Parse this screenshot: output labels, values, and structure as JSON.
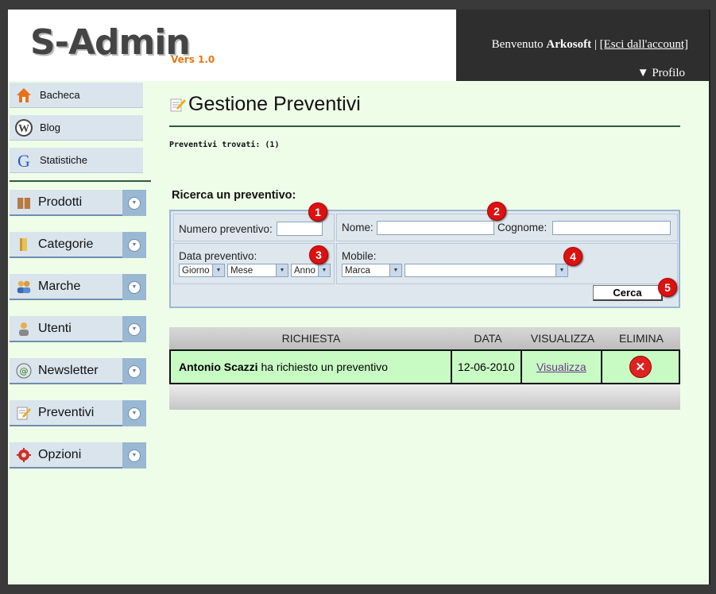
{
  "header": {
    "logo_text": "S-Admin",
    "logo_version": "Vers 1.0",
    "welcome_prefix": "Benvenuto",
    "username": "Arkosoft",
    "separator": "|",
    "logout_label": "[Esci dall'account]",
    "profile_label": "▼ Profilo"
  },
  "sidebar": {
    "top_items": [
      {
        "label": "Bacheca",
        "icon": "home-icon"
      },
      {
        "label": "Blog",
        "icon": "wordpress-icon"
      },
      {
        "label": "Statistiche",
        "icon": "google-icon"
      }
    ],
    "menu_items": [
      {
        "label": "Prodotti",
        "icon": "box-icon"
      },
      {
        "label": "Categorie",
        "icon": "folder-icon"
      },
      {
        "label": "Marche",
        "icon": "users-icon"
      },
      {
        "label": "Utenti",
        "icon": "user-icon"
      },
      {
        "label": "Newsletter",
        "icon": "email-icon"
      },
      {
        "label": "Preventivi",
        "icon": "document-edit-icon"
      },
      {
        "label": "Opzioni",
        "icon": "gear-icon"
      }
    ]
  },
  "main": {
    "page_title": "Gestione Preventivi",
    "found_text": "Preventivi trovati: (1)",
    "search": {
      "title": "Ricerca un preventivo:",
      "numero_label": "Numero preventivo:",
      "nome_label": "Nome:",
      "cognome_label": "Cognome:",
      "data_label": "Data preventivo:",
      "giorno": "Giorno",
      "mese": "Mese",
      "anno": "Anno",
      "mobile_label": "Mobile:",
      "marca": "Marca",
      "modello": "",
      "button_label": "Cerca",
      "badges": [
        "1",
        "2",
        "3",
        "4",
        "5"
      ]
    },
    "table": {
      "headers": [
        "RICHIESTA",
        "DATA",
        "VISUALIZZA",
        "ELIMINA"
      ],
      "rows": [
        {
          "name": "Antonio Scazzi",
          "text": " ha richiesto un preventivo",
          "date": "12-06-2010",
          "view": "Visualizza"
        }
      ]
    }
  },
  "colors": {
    "background": "#eefde8",
    "topbar": "#2e2e2e",
    "accent_line": "#2e5a3e",
    "row_highlight": "#c8fbc4",
    "badge": "#dd1111"
  }
}
